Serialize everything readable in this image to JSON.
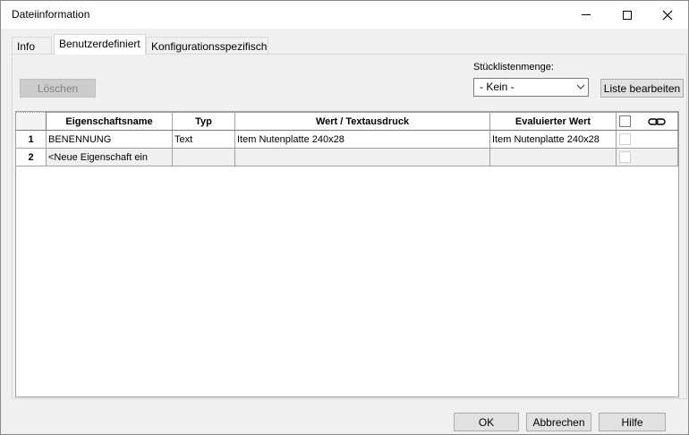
{
  "window": {
    "title": "Dateiinformation"
  },
  "tabs": [
    {
      "label": "Info",
      "active": false
    },
    {
      "label": "Benutzerdefiniert",
      "active": true
    },
    {
      "label": "Konfigurationsspezifisch",
      "active": false
    }
  ],
  "toolbar": {
    "delete_label": "Löschen",
    "bom_label": "Stücklistenmenge:",
    "bom_value": "- Kein -",
    "edit_list_label": "Liste bearbeiten"
  },
  "table": {
    "headers": [
      "Eigenschaftsname",
      "Typ",
      "Wert / Textausdruck",
      "Evaluierter Wert"
    ],
    "rows": [
      {
        "num": "1",
        "name": "BENENNUNG",
        "type": "Text",
        "value": "Item Nutenplatte 240x28",
        "evaluated": "Item Nutenplatte 240x28"
      },
      {
        "num": "2",
        "name": "<Neue Eigenschaft ein",
        "type": "",
        "value": "",
        "evaluated": ""
      }
    ]
  },
  "footer": {
    "ok_label": "OK",
    "cancel_label": "Abbrechen",
    "help_label": "Hilfe"
  },
  "icons": {
    "minimize": "minimize-icon",
    "maximize": "maximize-icon",
    "close": "close-icon",
    "link": "link-icon",
    "dropdown": "chevron-down-icon"
  }
}
